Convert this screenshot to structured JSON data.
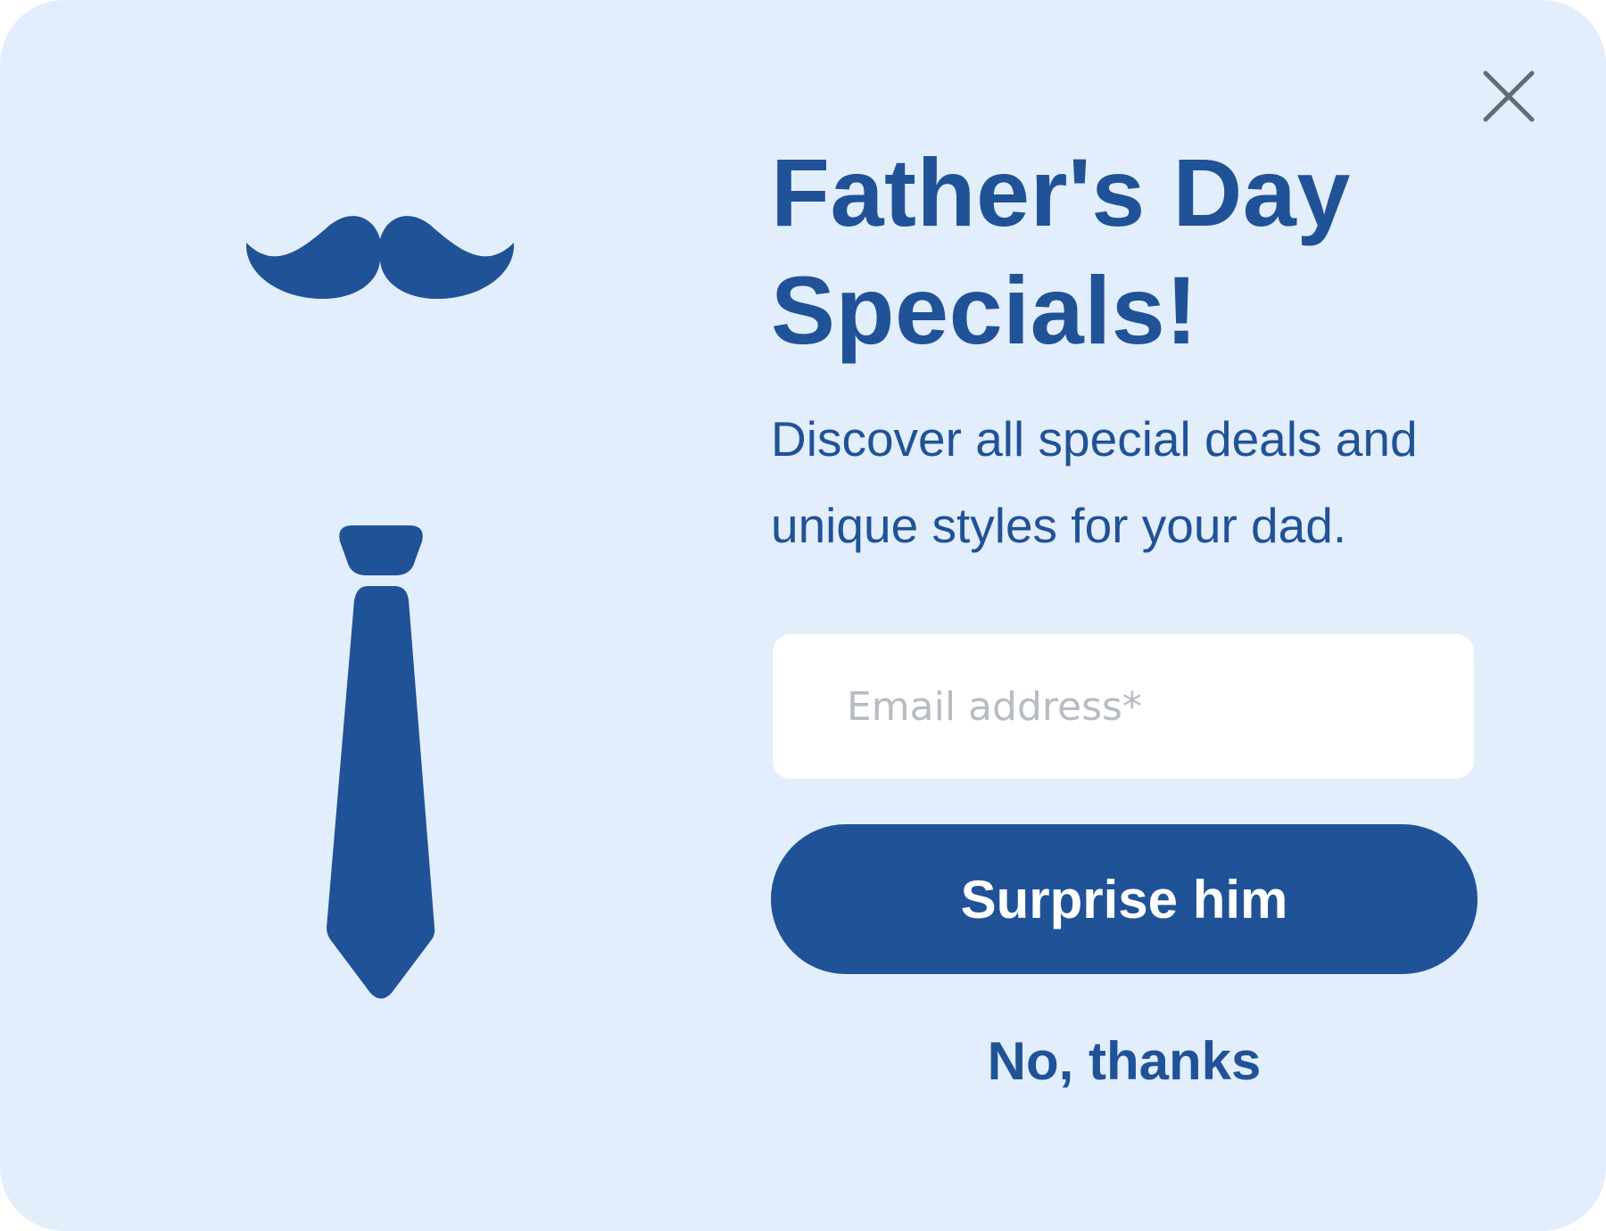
{
  "popup": {
    "title": "Father's Day Specials!",
    "subtitle": "Discover all special deals and unique styles for your dad.",
    "email": {
      "placeholder": "Email address*",
      "value": ""
    },
    "submit_label": "Surprise him",
    "decline_label": "No, thanks"
  },
  "icons": {
    "close": "close-icon",
    "mustache": "mustache-icon",
    "tie": "tie-icon"
  },
  "colors": {
    "background": "#e3eefc",
    "brand": "#205297",
    "close_icon": "#636b74",
    "field_background": "#ffffff",
    "placeholder": "#b7bcc4",
    "button_text": "#ffffff"
  }
}
